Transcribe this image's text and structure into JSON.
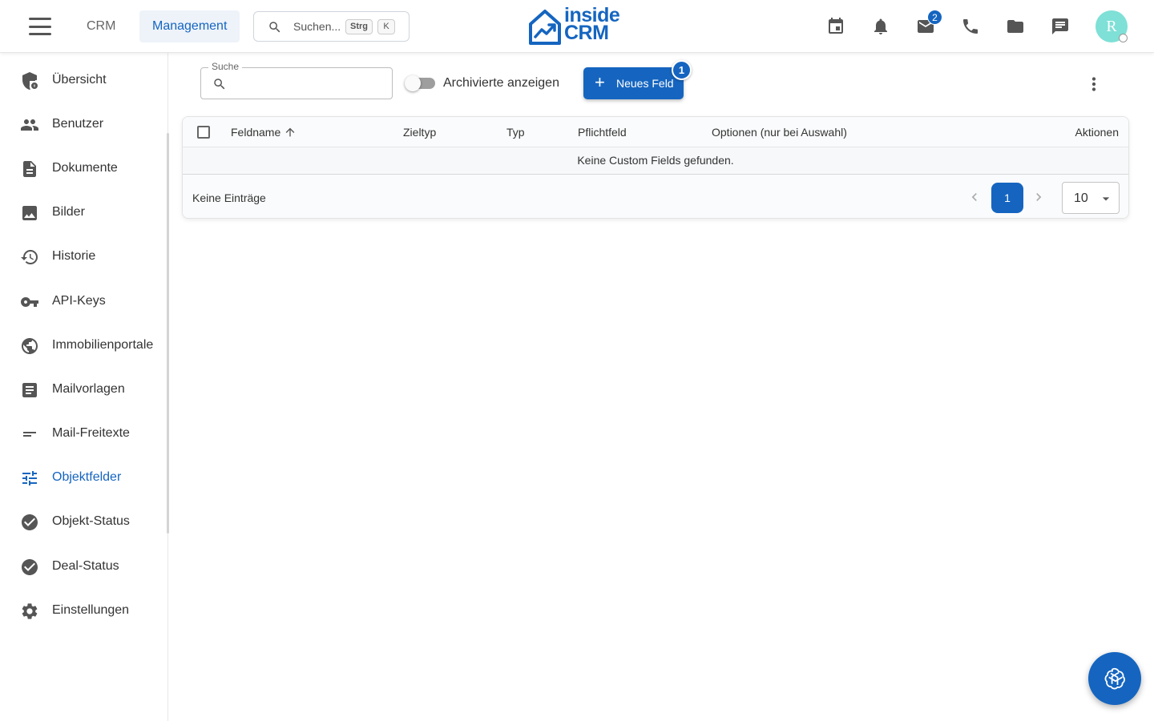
{
  "header": {
    "nav_tabs": [
      {
        "label": "CRM",
        "active": false
      },
      {
        "label": "Management",
        "active": true
      }
    ],
    "search": {
      "placeholder": "Suchen...",
      "shortcut_keys": [
        "Strg",
        "K"
      ]
    },
    "logo": {
      "line1": "inside",
      "line2": "CRM"
    },
    "icons": [
      "calendar-icon",
      "bell-icon",
      "mail-icon",
      "phone-icon",
      "folder-icon",
      "chat-icon"
    ],
    "mail_badge_count": "2",
    "avatar_initial": "R"
  },
  "sidebar": {
    "items": [
      {
        "label": "Übersicht",
        "icon": "shield-icon"
      },
      {
        "label": "Benutzer",
        "icon": "users-icon"
      },
      {
        "label": "Dokumente",
        "icon": "document-icon"
      },
      {
        "label": "Bilder",
        "icon": "image-icon"
      },
      {
        "label": "Historie",
        "icon": "history-icon"
      },
      {
        "label": "API-Keys",
        "icon": "key-icon"
      },
      {
        "label": "Immobilienportale",
        "icon": "globe-icon"
      },
      {
        "label": "Mailvorlagen",
        "icon": "article-icon"
      },
      {
        "label": "Mail-Freitexte",
        "icon": "short-text-icon"
      },
      {
        "label": "Objektfelder",
        "icon": "tune-icon",
        "active": true
      },
      {
        "label": "Objekt-Status",
        "icon": "check-circle-icon"
      },
      {
        "label": "Deal-Status",
        "icon": "check-circle-icon"
      },
      {
        "label": "Einstellungen",
        "icon": "settings-icon"
      }
    ]
  },
  "toolbar": {
    "search_legend": "Suche",
    "search_value": "",
    "archived_toggle_label": "Archivierte anzeigen",
    "archived_toggle_on": false,
    "new_field_label": "Neues Feld",
    "new_field_step_badge": "1"
  },
  "table": {
    "columns": [
      "Feldname",
      "Zieltyp",
      "Typ",
      "Pflichtfeld",
      "Optionen (nur bei Auswahl)",
      "Aktionen"
    ],
    "sort_column": "Feldname",
    "sort_direction": "ascending",
    "empty_message": "Keine Custom Fields gefunden.",
    "footer_entries": "Keine Einträge",
    "current_page": "1",
    "page_size": "10"
  },
  "colors": {
    "accent": "#1565c0",
    "avatar": "#7ee0d6"
  }
}
